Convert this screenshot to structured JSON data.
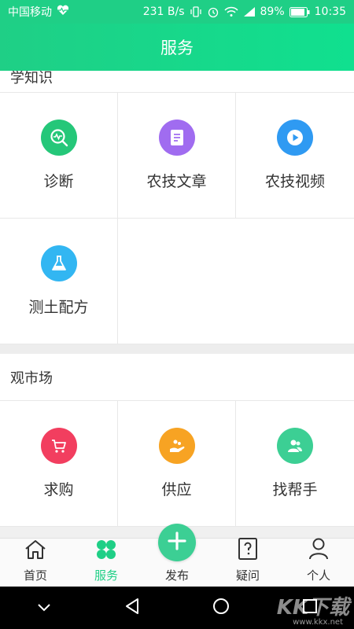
{
  "status_bar": {
    "carrier": "中国移动",
    "speed": "231 B/s",
    "battery": "89%",
    "time": "10:35"
  },
  "header": {
    "title": "服务"
  },
  "sections": [
    {
      "title": "学知识",
      "items": [
        {
          "label": "诊断",
          "icon": "diagnosis-icon",
          "color": "#25c779"
        },
        {
          "label": "农技文章",
          "icon": "article-icon",
          "color": "#a06cf0"
        },
        {
          "label": "农技视频",
          "icon": "video-icon",
          "color": "#2f9af2"
        },
        {
          "label": "测土配方",
          "icon": "flask-icon",
          "color": "#32b6f2"
        }
      ]
    },
    {
      "title": "观市场",
      "items": [
        {
          "label": "求购",
          "icon": "cart-icon",
          "color": "#f23e5f"
        },
        {
          "label": "供应",
          "icon": "supply-icon",
          "color": "#f7a323"
        },
        {
          "label": "找帮手",
          "icon": "helper-icon",
          "color": "#3ccf94"
        }
      ]
    }
  ],
  "bottom_nav": {
    "home": "首页",
    "service": "服务",
    "publish": "发布",
    "question": "疑问",
    "personal": "个人"
  },
  "watermark": {
    "text": "KK下载",
    "url": "www.kkx.net"
  },
  "colors": {
    "accent": "#1fcf86"
  }
}
